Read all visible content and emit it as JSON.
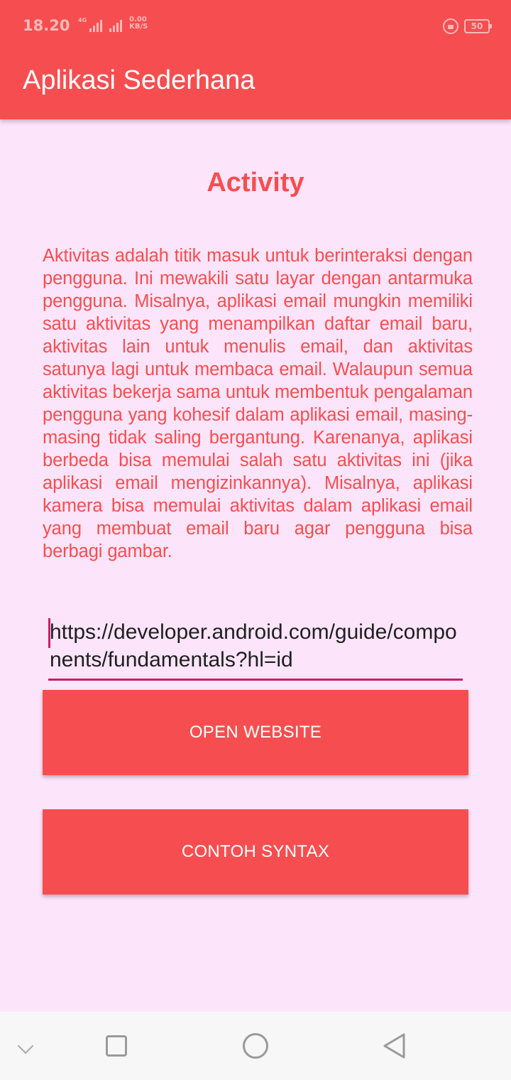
{
  "status_bar": {
    "time": "18.20",
    "network_label": "4G",
    "speed_value": "0.00",
    "speed_unit": "KB/S",
    "battery": "50"
  },
  "app_bar": {
    "title": "Aplikasi Sederhana"
  },
  "content": {
    "heading": "Activity",
    "description": "Aktivitas adalah titik masuk untuk berinteraksi dengan pengguna. Ini mewakili satu layar dengan antarmuka pengguna. Misalnya, aplikasi email mungkin memiliki satu aktivitas yang menampilkan daftar email baru, aktivitas lain untuk menulis email, dan aktivitas satunya lagi untuk membaca email. Walaupun semua aktivitas bekerja sama untuk membentuk pengalaman pengguna yang kohesif dalam aplikasi email, masing-masing tidak saling bergantung. Karenanya, aplikasi berbeda bisa memulai salah satu aktivitas ini (jika aplikasi email mengizinkannya). Misalnya, aplikasi kamera bisa memulai aktivitas dalam aplikasi email yang membuat email baru agar pengguna bisa berbagi gambar.",
    "url_value": "https://developer.android.com/guide/components/fundamentals?hl=id",
    "open_website_label": "OPEN WEBSITE",
    "contoh_syntax_label": "CONTOH SYNTAX"
  },
  "nav_bar": {
    "icons": [
      "chevron-down-icon",
      "recents-square-icon",
      "home-circle-icon",
      "back-triangle-icon"
    ]
  },
  "colors": {
    "primary": "#f64e50",
    "background": "#fce4fa",
    "accent": "#c8206a"
  }
}
